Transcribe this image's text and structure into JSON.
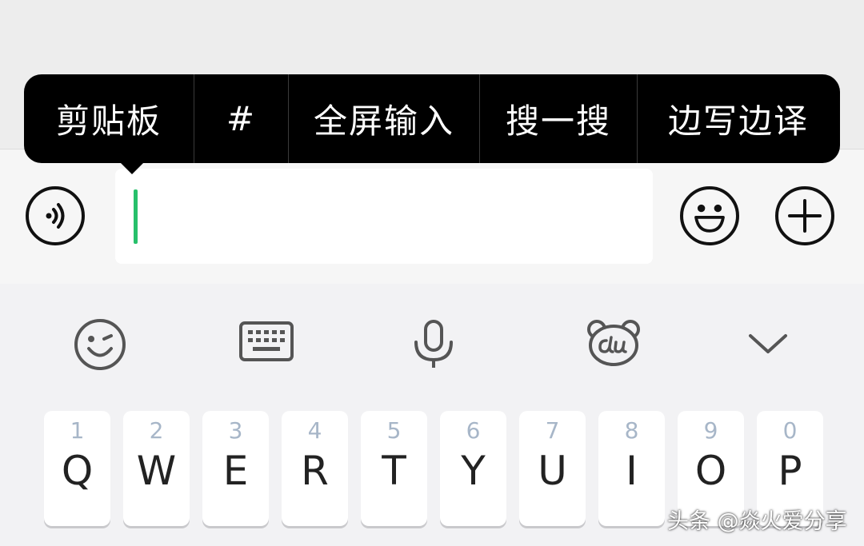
{
  "popup_menu": {
    "items": [
      "剪贴板",
      "#",
      "全屏输入",
      "搜一搜",
      "边写边译"
    ]
  },
  "input_bar": {
    "voice_icon": "voice-icon",
    "emoji_icon": "emoji-icon",
    "plus_icon": "plus-icon",
    "text_value": ""
  },
  "keyboard": {
    "toolbar": [
      "smiley-wink-icon",
      "keyboard-icon",
      "microphone-icon",
      "baidu-du-icon",
      "chevron-down-icon"
    ],
    "keys": [
      {
        "num": "1",
        "letter": "Q"
      },
      {
        "num": "2",
        "letter": "W"
      },
      {
        "num": "3",
        "letter": "E"
      },
      {
        "num": "4",
        "letter": "R"
      },
      {
        "num": "5",
        "letter": "T"
      },
      {
        "num": "6",
        "letter": "Y"
      },
      {
        "num": "7",
        "letter": "U"
      },
      {
        "num": "8",
        "letter": "I"
      },
      {
        "num": "9",
        "letter": "O"
      },
      {
        "num": "0",
        "letter": "P"
      }
    ]
  },
  "watermark": "头条 @焱火爱分享",
  "colors": {
    "caret": "#27c06b",
    "popup_bg": "#000000",
    "key_number": "#a7b6c8"
  }
}
